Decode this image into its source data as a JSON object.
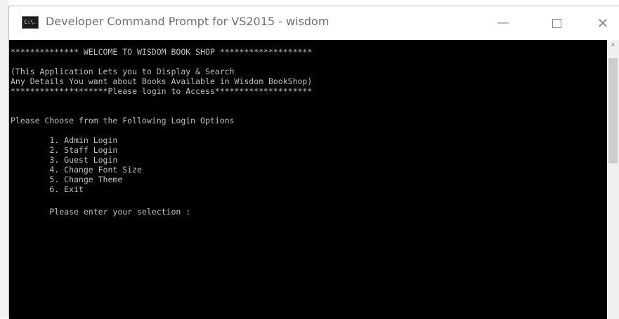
{
  "window": {
    "icon_label": "C:\\.",
    "title": "Developer Command Prompt for VS2015 - wisdom",
    "minimize_glyph": "—",
    "close_glyph": "✕"
  },
  "console": {
    "lines": [
      "************** WELCOME TO WISDOM BOOK SHOP *******************",
      "",
      "(This Application Lets you to Display & Search",
      "Any Details You want about Books Available in Wisdom BookShop)",
      "********************Please login to Access********************",
      "",
      "",
      "Please Choose from the Following Login Options",
      "",
      "        1. Admin Login",
      "        2. Staff Login",
      "        3. Guest Login",
      "        4. Change Font Size",
      "        5. Change Theme",
      "        6. Exit",
      "",
      "        Please enter your selection :"
    ]
  },
  "scrollbar": {
    "up_glyph": "^"
  },
  "theme": {
    "console_bg": "#000000",
    "console_fg": "#c0c0c0",
    "title_fg": "#6f6f6f"
  }
}
